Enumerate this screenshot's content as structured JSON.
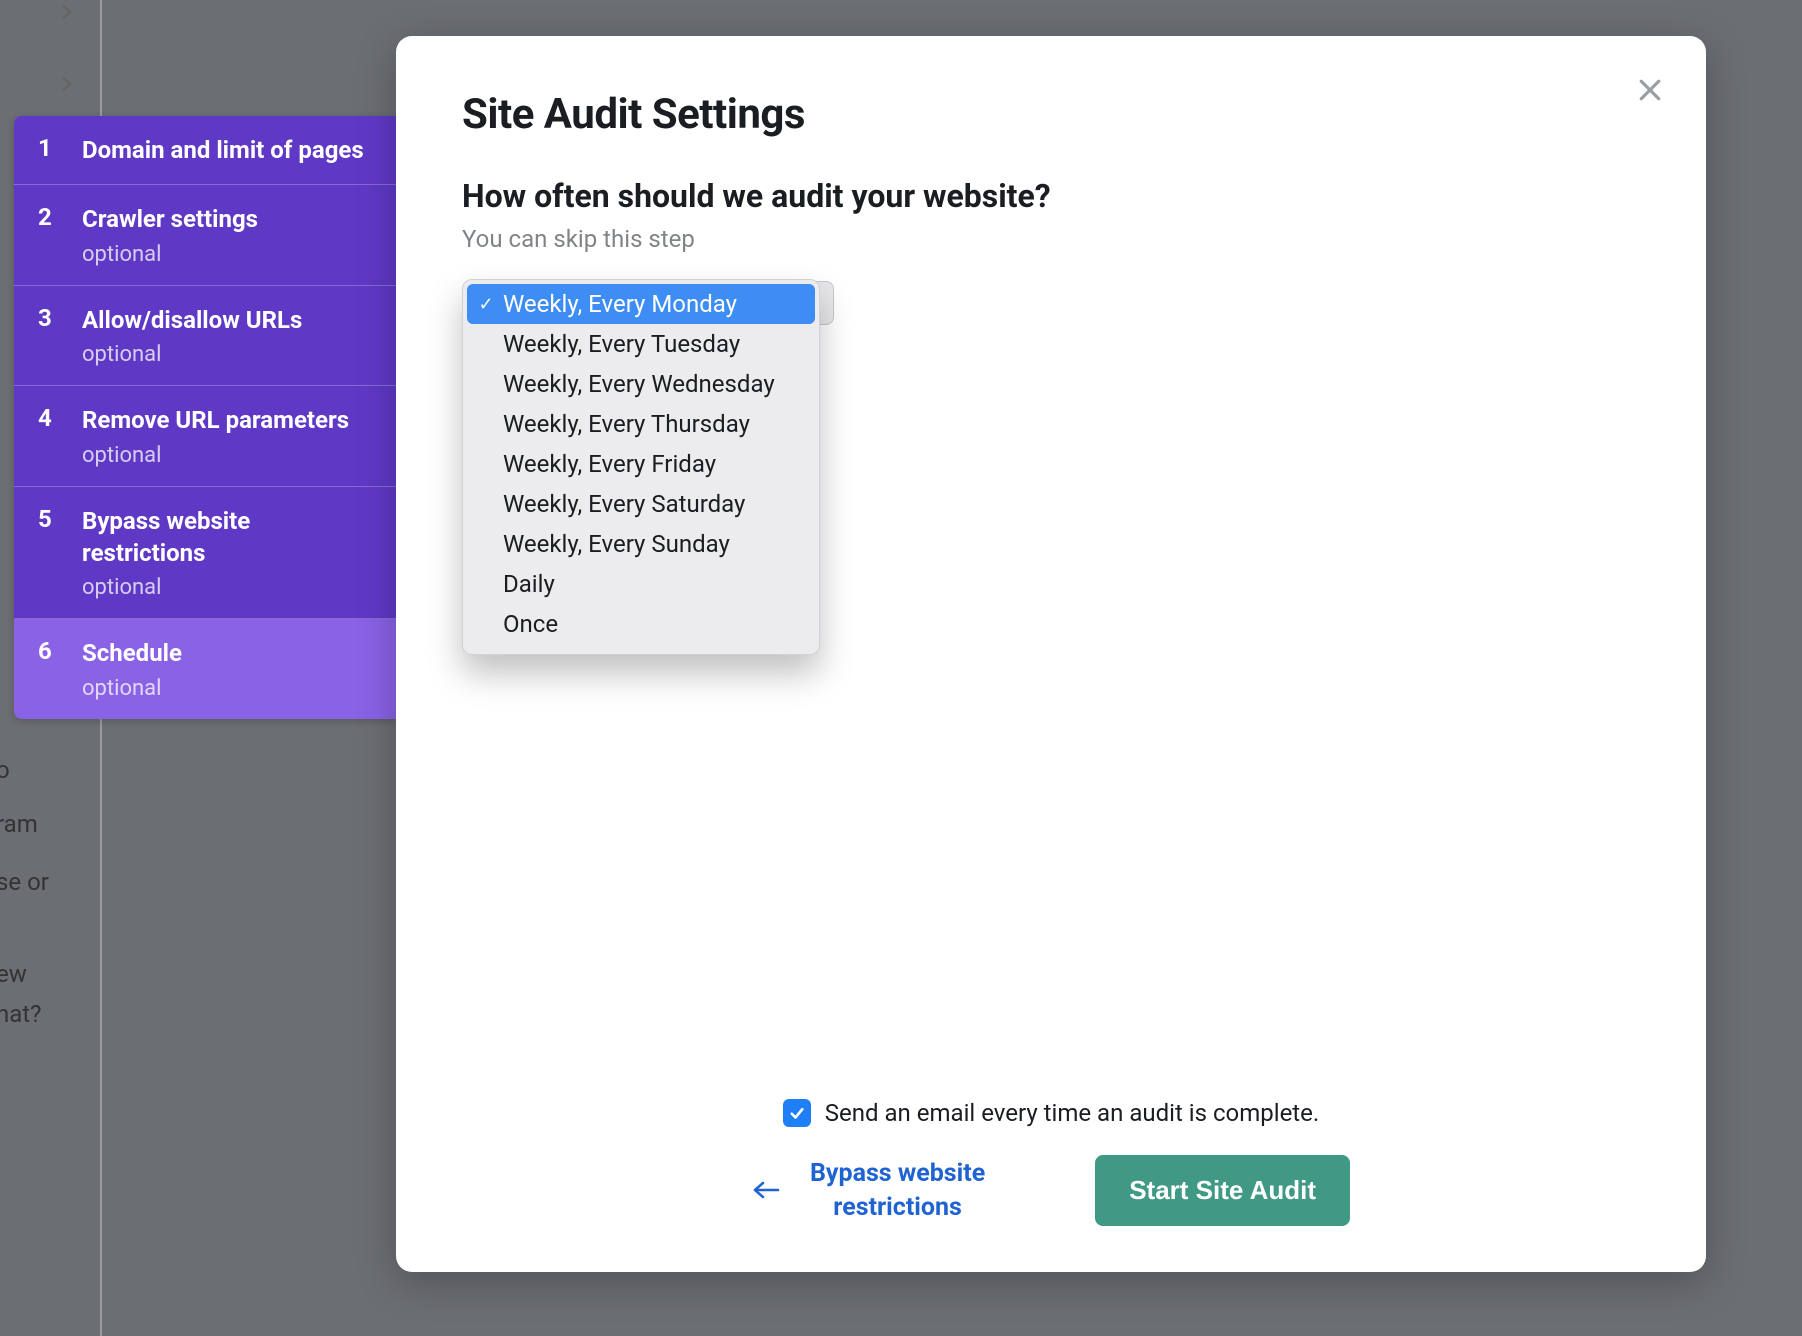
{
  "modal": {
    "title": "Site Audit Settings",
    "question": "How often should we audit your website?",
    "subtext": "You can skip this step",
    "close_icon": "close-icon"
  },
  "wizard": {
    "steps": [
      {
        "num": "1",
        "label": "Domain and limit of pages",
        "optional": ""
      },
      {
        "num": "2",
        "label": "Crawler settings",
        "optional": "optional"
      },
      {
        "num": "3",
        "label": "Allow/disallow URLs",
        "optional": "optional"
      },
      {
        "num": "4",
        "label": "Remove URL parameters",
        "optional": "optional"
      },
      {
        "num": "5",
        "label": "Bypass website restrictions",
        "optional": "optional"
      },
      {
        "num": "6",
        "label": "Schedule",
        "optional": "optional"
      }
    ],
    "active_index": 5
  },
  "schedule": {
    "options": [
      "Weekly, Every Monday",
      "Weekly, Every Tuesday",
      "Weekly, Every Wednesday",
      "Weekly, Every Thursday",
      "Weekly, Every Friday",
      "Weekly, Every Saturday",
      "Weekly, Every Sunday",
      "Daily",
      "Once"
    ],
    "selected_index": 0
  },
  "footer": {
    "email_label": "Send an email every time an audit is complete.",
    "email_checked": true,
    "back_label": "Bypass website restrictions",
    "primary_label": "Start Site Audit"
  },
  "background": {
    "frag1": "o",
    "frag2": "ram",
    "frag3": "se or",
    "frag4": "ew",
    "frag5": "nat?"
  }
}
